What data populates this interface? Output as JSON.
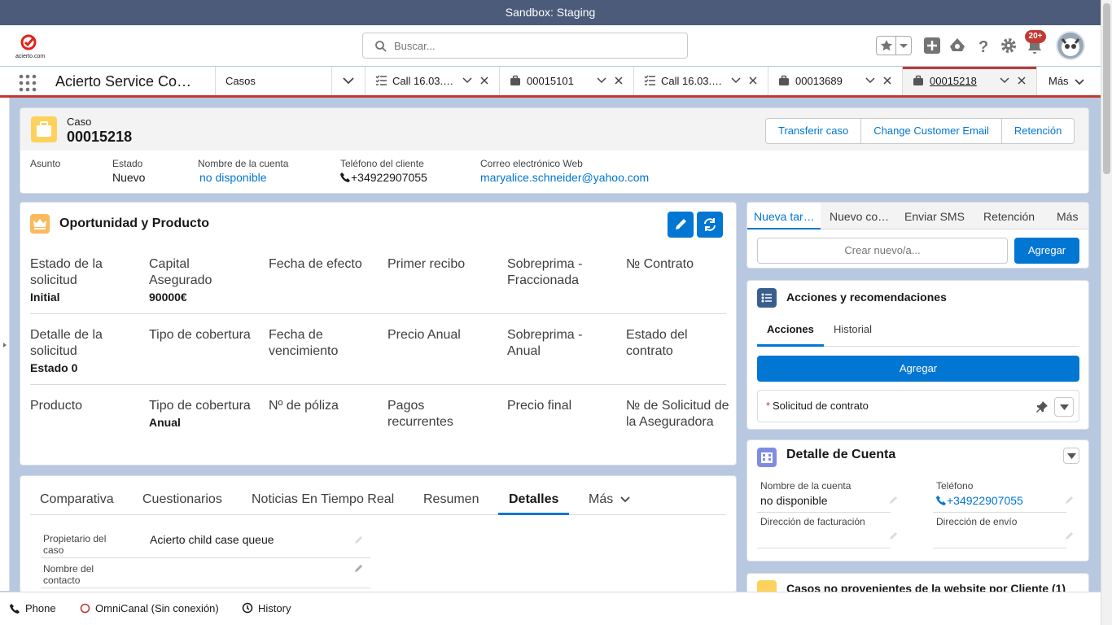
{
  "sandbox_banner": "Sandbox: Staging",
  "header": {
    "logo_text": "acierto.com",
    "search_placeholder": "Buscar...",
    "notifications_badge": "20+"
  },
  "nav": {
    "app_name": "Acierto Service Co…",
    "object_selector": "Casos",
    "tabs": [
      {
        "label": "Call 16.03.…",
        "icon": "call-list-icon",
        "active": false
      },
      {
        "label": "00015101",
        "icon": "briefcase-icon",
        "active": false
      },
      {
        "label": "Call 16.03.…",
        "icon": "call-list-icon",
        "active": false
      },
      {
        "label": "00013689",
        "icon": "briefcase-icon",
        "active": false
      },
      {
        "label": "00015218",
        "icon": "briefcase-icon",
        "active": true
      }
    ],
    "more_label": "Más"
  },
  "case": {
    "type_label": "Caso",
    "number": "00015218",
    "actions": [
      "Transferir caso",
      "Change Customer Email",
      "Retención"
    ],
    "fields": [
      {
        "label": "Asunto",
        "value": ""
      },
      {
        "label": "Estado",
        "value": "Nuevo"
      },
      {
        "label": "Nombre de la cuenta",
        "value": "no disponible"
      },
      {
        "label": "Teléfono del cliente",
        "value": "+34922907055"
      },
      {
        "label": "Correo electrónico Web",
        "value": "maryalice.schneider@yahoo.com"
      }
    ]
  },
  "opportunity": {
    "title": "Oportunidad y Producto",
    "rows": [
      [
        {
          "label": "Estado de la solicitud",
          "value": "Initial"
        },
        {
          "label": "Capital Asegurado",
          "value": "90000€"
        },
        {
          "label": "Fecha de efecto",
          "value": ""
        },
        {
          "label": "Primer recibo",
          "value": ""
        },
        {
          "label": "Sobreprima - Fraccionada",
          "value": ""
        },
        {
          "label": "№ Contrato",
          "value": ""
        }
      ],
      [
        {
          "label": "Detalle de la solicitud",
          "value": "Estado 0"
        },
        {
          "label": "Tipo de cobertura",
          "value": ""
        },
        {
          "label": "Fecha de vencimiento",
          "value": ""
        },
        {
          "label": "Precio Anual",
          "value": ""
        },
        {
          "label": "Sobreprima - Anual",
          "value": ""
        },
        {
          "label": "Estado del contrato",
          "value": ""
        }
      ],
      [
        {
          "label": "Producto",
          "value": ""
        },
        {
          "label": "Tipo de cobertura",
          "value": "Anual"
        },
        {
          "label": "Nº de póliza",
          "value": ""
        },
        {
          "label": "Pagos recurrentes",
          "value": ""
        },
        {
          "label": "Precio final",
          "value": ""
        },
        {
          "label": "№ de Solicitud de la Aseguradora",
          "value": ""
        }
      ]
    ]
  },
  "details": {
    "tabs": [
      "Comparativa",
      "Cuestionarios",
      "Noticias En Tiempo Real",
      "Resumen",
      "Detalles",
      "Más"
    ],
    "active_tab": "Detalles",
    "fields": [
      {
        "label": "Propietario del caso",
        "value": "Acierto child case queue"
      },
      {
        "label": "Nombre del contacto",
        "value": ""
      }
    ]
  },
  "activity": {
    "tabs": [
      "Nueva tar…",
      "Nuevo co…",
      "Enviar SMS",
      "Retención",
      "Más"
    ],
    "input_placeholder": "Crear nuevo/a...",
    "add_label": "Agregar"
  },
  "recommendations": {
    "title": "Acciones y recomendaciones",
    "tabs": [
      "Acciones",
      "Historial"
    ],
    "add_label": "Agregar",
    "item_required_mark": "*",
    "item_label": "Solicitud de contrato"
  },
  "account_detail": {
    "title": "Detalle de Cuenta",
    "fields": [
      {
        "label": "Nombre de la cuenta",
        "value": "no disponible"
      },
      {
        "label": "Teléfono",
        "value": "+34922907055"
      },
      {
        "label": "Dirección de facturación",
        "value": ""
      },
      {
        "label": "Dirección de envío",
        "value": ""
      }
    ]
  },
  "non_web_cases": {
    "title": "Casos no provenientes de la website por Cliente (1)"
  },
  "footer": {
    "items": [
      "Phone",
      "OmniCanal (Sin conexión)",
      "History"
    ]
  },
  "colors": {
    "brand_blue": "#0176d3",
    "active_red": "#c23934",
    "sandbox_bar": "#4b5b79"
  }
}
